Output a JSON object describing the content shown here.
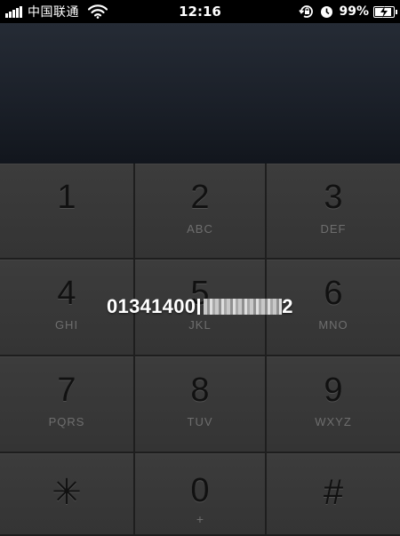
{
  "status_bar": {
    "carrier": "中国联通",
    "time": "12:16",
    "battery_percent": "99%",
    "battery_level": 0.99,
    "icons": [
      "signal-icon",
      "wifi-icon",
      "rotation-lock-icon",
      "alarm-icon",
      "battery-icon",
      "charging-icon"
    ]
  },
  "dialer": {
    "number_prefix": "01341400",
    "number_suffix": "2"
  },
  "keypad": {
    "keys": [
      {
        "digit": "1",
        "letters": ""
      },
      {
        "digit": "2",
        "letters": "ABC"
      },
      {
        "digit": "3",
        "letters": "DEF"
      },
      {
        "digit": "4",
        "letters": "GHI"
      },
      {
        "digit": "5",
        "letters": "JKL"
      },
      {
        "digit": "6",
        "letters": "MNO"
      },
      {
        "digit": "7",
        "letters": "PQRS"
      },
      {
        "digit": "8",
        "letters": "TUV"
      },
      {
        "digit": "9",
        "letters": "WXYZ"
      },
      {
        "digit": "✳",
        "letters": ""
      },
      {
        "digit": "0",
        "letters": "+"
      },
      {
        "digit": "#",
        "letters": ""
      }
    ]
  },
  "colors": {
    "key_face": "#383838",
    "key_digit": "#111111",
    "key_letters": "#6e6e6e",
    "display_bg": "#1b2029",
    "number_text": "#ffffff"
  }
}
